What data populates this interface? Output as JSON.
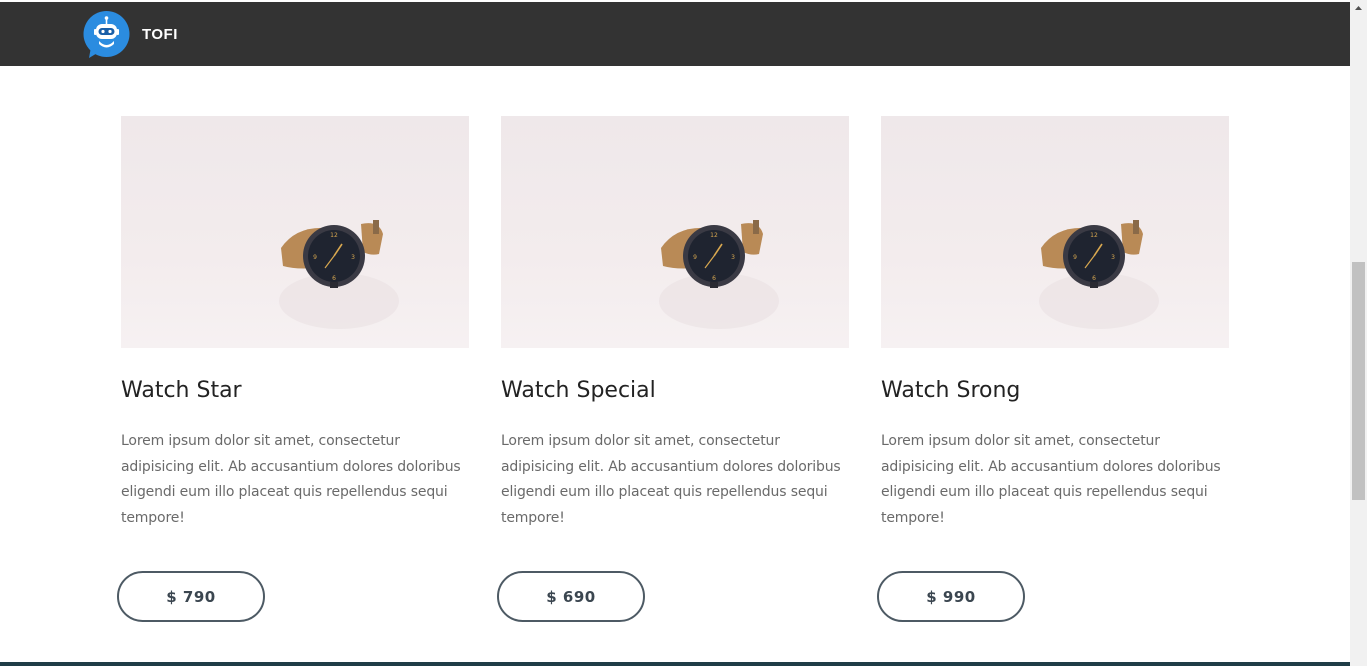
{
  "header": {
    "brand": "TOFI",
    "logo_icon": "robot-chat-icon",
    "background": "#333333"
  },
  "products": [
    {
      "title": "Watch Star",
      "description": "Lorem ipsum dolor sit amet, consectetur adipisicing elit. Ab accusantium dolores doloribus eligendi eum illo placeat quis repellendus sequi tempore!",
      "price": "$ 790",
      "image_icon": "wristwatch-image"
    },
    {
      "title": "Watch Special",
      "description": "Lorem ipsum dolor sit amet, consectetur adipisicing elit. Ab accusantium dolores doloribus eligendi eum illo placeat quis repellendus sequi tempore!",
      "price": "$ 690",
      "image_icon": "wristwatch-image"
    },
    {
      "title": "Watch Srong",
      "description": "Lorem ipsum dolor sit amet, consectetur adipisicing elit. Ab accusantium dolores doloribus eligendi eum illo placeat quis repellendus sequi tempore!",
      "price": "$ 990",
      "image_icon": "wristwatch-image"
    }
  ],
  "colors": {
    "accent_logo": "#2b8ce0",
    "button_border": "#4d5a64"
  }
}
